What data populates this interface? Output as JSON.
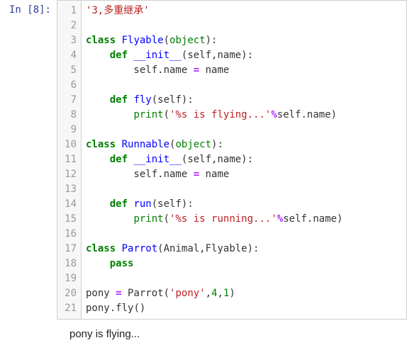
{
  "prompt": {
    "label": "In [8]:"
  },
  "code": {
    "lines": [
      {
        "n": "1",
        "tokens": [
          {
            "t": "'3,多重继承'",
            "c": "c-comment"
          }
        ]
      },
      {
        "n": "2",
        "tokens": []
      },
      {
        "n": "3",
        "tokens": [
          {
            "t": "class",
            "c": "c-kw"
          },
          {
            "t": " ",
            "c": ""
          },
          {
            "t": "Flyable",
            "c": "c-cls"
          },
          {
            "t": "(",
            "c": "c-paren"
          },
          {
            "t": "object",
            "c": "c-builtin"
          },
          {
            "t": "):",
            "c": "c-paren"
          }
        ]
      },
      {
        "n": "4",
        "tokens": [
          {
            "t": "    ",
            "c": ""
          },
          {
            "t": "def",
            "c": "c-kw"
          },
          {
            "t": " ",
            "c": ""
          },
          {
            "t": "__init__",
            "c": "c-def"
          },
          {
            "t": "(self,name):",
            "c": "c-paren"
          }
        ]
      },
      {
        "n": "5",
        "tokens": [
          {
            "t": "        self.name ",
            "c": "c-txt"
          },
          {
            "t": "=",
            "c": "c-op"
          },
          {
            "t": " name",
            "c": "c-txt"
          }
        ]
      },
      {
        "n": "6",
        "tokens": []
      },
      {
        "n": "7",
        "tokens": [
          {
            "t": "    ",
            "c": ""
          },
          {
            "t": "def",
            "c": "c-kw"
          },
          {
            "t": " ",
            "c": ""
          },
          {
            "t": "fly",
            "c": "c-def"
          },
          {
            "t": "(self):",
            "c": "c-paren"
          }
        ]
      },
      {
        "n": "8",
        "tokens": [
          {
            "t": "        ",
            "c": ""
          },
          {
            "t": "print",
            "c": "c-builtin"
          },
          {
            "t": "(",
            "c": "c-paren"
          },
          {
            "t": "'%s is flying...'",
            "c": "c-str"
          },
          {
            "t": "%",
            "c": "c-op"
          },
          {
            "t": "self.name)",
            "c": "c-txt"
          }
        ]
      },
      {
        "n": "9",
        "tokens": []
      },
      {
        "n": "10",
        "tokens": [
          {
            "t": "class",
            "c": "c-kw"
          },
          {
            "t": " ",
            "c": ""
          },
          {
            "t": "Runnable",
            "c": "c-cls"
          },
          {
            "t": "(",
            "c": "c-paren"
          },
          {
            "t": "object",
            "c": "c-builtin"
          },
          {
            "t": "):",
            "c": "c-paren"
          }
        ]
      },
      {
        "n": "11",
        "tokens": [
          {
            "t": "    ",
            "c": ""
          },
          {
            "t": "def",
            "c": "c-kw"
          },
          {
            "t": " ",
            "c": ""
          },
          {
            "t": "__init__",
            "c": "c-def"
          },
          {
            "t": "(self,name):",
            "c": "c-paren"
          }
        ]
      },
      {
        "n": "12",
        "tokens": [
          {
            "t": "        self.name ",
            "c": "c-txt"
          },
          {
            "t": "=",
            "c": "c-op"
          },
          {
            "t": " name",
            "c": "c-txt"
          }
        ]
      },
      {
        "n": "13",
        "tokens": []
      },
      {
        "n": "14",
        "tokens": [
          {
            "t": "    ",
            "c": ""
          },
          {
            "t": "def",
            "c": "c-kw"
          },
          {
            "t": " ",
            "c": ""
          },
          {
            "t": "run",
            "c": "c-def"
          },
          {
            "t": "(self):",
            "c": "c-paren"
          }
        ]
      },
      {
        "n": "15",
        "tokens": [
          {
            "t": "        ",
            "c": ""
          },
          {
            "t": "print",
            "c": "c-builtin"
          },
          {
            "t": "(",
            "c": "c-paren"
          },
          {
            "t": "'%s is running...'",
            "c": "c-str"
          },
          {
            "t": "%",
            "c": "c-op"
          },
          {
            "t": "self.name)",
            "c": "c-txt"
          }
        ]
      },
      {
        "n": "16",
        "tokens": []
      },
      {
        "n": "17",
        "tokens": [
          {
            "t": "class",
            "c": "c-kw"
          },
          {
            "t": " ",
            "c": ""
          },
          {
            "t": "Parrot",
            "c": "c-cls"
          },
          {
            "t": "(Animal,Flyable):",
            "c": "c-paren"
          }
        ]
      },
      {
        "n": "18",
        "tokens": [
          {
            "t": "    ",
            "c": ""
          },
          {
            "t": "pass",
            "c": "c-kw"
          }
        ]
      },
      {
        "n": "19",
        "tokens": []
      },
      {
        "n": "20",
        "tokens": [
          {
            "t": "pony ",
            "c": "c-txt"
          },
          {
            "t": "=",
            "c": "c-op"
          },
          {
            "t": " Parrot(",
            "c": "c-txt"
          },
          {
            "t": "'pony'",
            "c": "c-str"
          },
          {
            "t": ",",
            "c": "c-txt"
          },
          {
            "t": "4",
            "c": "c-num"
          },
          {
            "t": ",",
            "c": "c-txt"
          },
          {
            "t": "1",
            "c": "c-num"
          },
          {
            "t": ")",
            "c": "c-txt"
          }
        ]
      },
      {
        "n": "21",
        "tokens": [
          {
            "t": "pony.fly",
            "c": "c-txt"
          },
          {
            "t": "()",
            "c": "c-paren"
          }
        ]
      }
    ]
  },
  "output": {
    "text": "pony is flying..."
  }
}
